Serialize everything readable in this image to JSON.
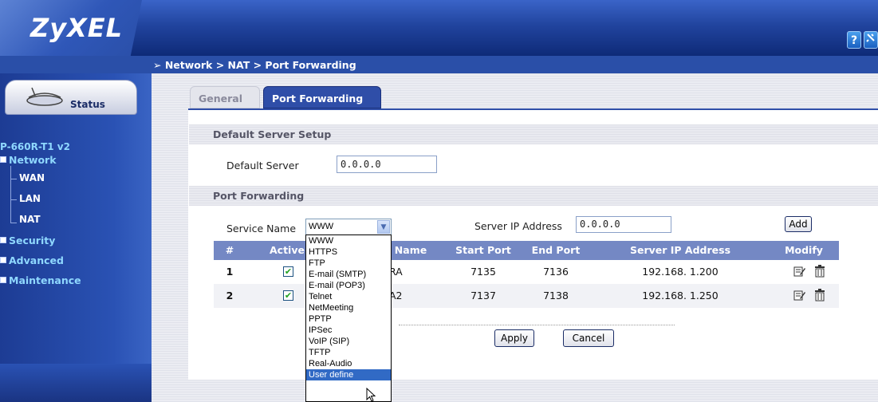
{
  "brand": {
    "logo_text": "ZyXEL"
  },
  "header": {
    "help_icon": "?",
    "wizard_icon": "wand"
  },
  "breadcrumb": "Network > NAT > Port Forwarding",
  "sidebar": {
    "status_label": "Status",
    "device_name": "P-660R-T1 v2",
    "items": [
      {
        "label": "Network",
        "expanded": true
      },
      {
        "label": "Security",
        "expanded": false
      },
      {
        "label": "Advanced",
        "expanded": false
      },
      {
        "label": "Maintenance",
        "expanded": false
      }
    ],
    "network_children": [
      "WAN",
      "LAN",
      "NAT"
    ]
  },
  "tabs": [
    {
      "label": "General",
      "active": false
    },
    {
      "label": "Port Forwarding",
      "active": true
    }
  ],
  "default_server": {
    "section_title": "Default Server Setup",
    "field_label": "Default Server",
    "value": "0.0.0.0"
  },
  "port_forwarding": {
    "section_title": "Port Forwarding",
    "service_name_label": "Service Name",
    "service_selected": "WWW",
    "server_ip_label": "Server IP Address",
    "server_ip_value": "0.0.0.0",
    "add_label": "Add",
    "service_options": [
      "WWW",
      "HTTPS",
      "FTP",
      "E-mail (SMTP)",
      "E-mail (POP3)",
      "Telnet",
      "NetMeeting",
      "PPTP",
      "IPSec",
      "VoIP (SIP)",
      "TFTP",
      "Real-Audio",
      "User define"
    ],
    "highlighted_option": "User define"
  },
  "table": {
    "headers": [
      "#",
      "Active",
      "Name",
      "Start Port",
      "End Port",
      "Server IP Address",
      "Modify"
    ],
    "rows": [
      {
        "num": "1",
        "active": true,
        "name_visible": "RA",
        "start_port": "7135",
        "end_port": "7136",
        "server_ip": "192.168. 1.200"
      },
      {
        "num": "2",
        "active": true,
        "name_visible": "A2",
        "start_port": "7137",
        "end_port": "7138",
        "server_ip": "192.168. 1.250"
      }
    ]
  },
  "buttons": {
    "apply": "Apply",
    "cancel": "Cancel"
  },
  "colors": {
    "accent": "#2f4ea8",
    "sidebar_text": "#8fd8ff",
    "table_header": "#7488c4"
  }
}
